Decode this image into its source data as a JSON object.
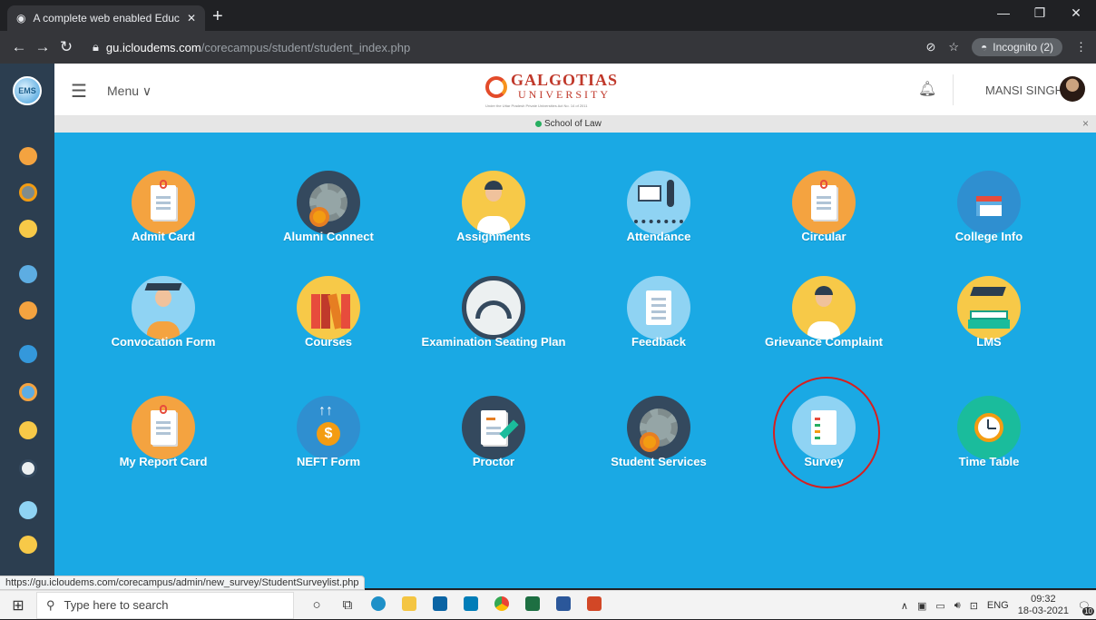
{
  "browser": {
    "tab_title": "A complete web enabled Educati",
    "tab_close": "✕",
    "new_tab": "+",
    "url_host": "gu.icloudems.com",
    "url_path": "/corecampus/student/student_index.php",
    "incognito_label": "Incognito (2)",
    "status_url": "https://gu.icloudems.com/corecampus/admin/new_survey/StudentSurveylist.php"
  },
  "header": {
    "menu_label": "Menu ∨",
    "brand_name": "GALGOTIAS",
    "brand_sub": "UNIVERSITY",
    "brand_tagline": "Under the Uttar Pradesh Private Universities Act No. 14 of 2011",
    "user_name": "MANSI SINGH"
  },
  "banner": {
    "school": "School of Law",
    "close": "×"
  },
  "sidebar": {
    "logo_text": "EMS"
  },
  "tiles": [
    {
      "label": "Admit Card"
    },
    {
      "label": "Alumni Connect"
    },
    {
      "label": "Assignments"
    },
    {
      "label": "Attendance"
    },
    {
      "label": "Circular"
    },
    {
      "label": "College Info"
    },
    {
      "label": "Convocation Form"
    },
    {
      "label": "Courses"
    },
    {
      "label": "Examination Seating Plan"
    },
    {
      "label": "Feedback"
    },
    {
      "label": "Grievance Complaint"
    },
    {
      "label": "LMS"
    },
    {
      "label": "My Report Card"
    },
    {
      "label": "NEFT Form"
    },
    {
      "label": "Proctor"
    },
    {
      "label": "Student Services"
    },
    {
      "label": "Survey"
    },
    {
      "label": "Time Table"
    }
  ],
  "taskbar": {
    "search_placeholder": "Type here to search",
    "lang": "ENG",
    "time": "09:32",
    "date": "18-03-2021",
    "notif_count": "10"
  },
  "colors": {
    "main_bg": "#1aa9e4",
    "sidebar_bg": "#2c3e50",
    "highlight_ring": "#d61f1f"
  }
}
